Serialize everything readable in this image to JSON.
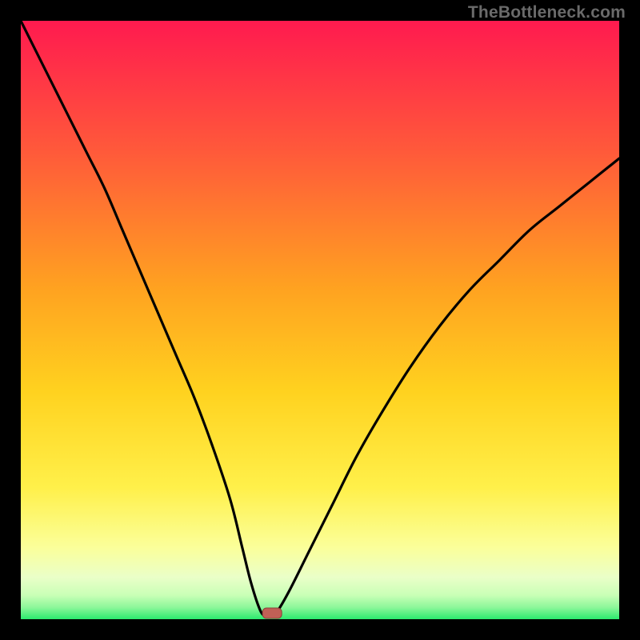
{
  "watermark": "TheBottleneck.com",
  "colors": {
    "frame": "#000000",
    "watermark_text": "#6a6a6a",
    "gradient_top": "#ff1a4f",
    "gradient_mid1": "#ff6a2f",
    "gradient_mid2": "#ffd21f",
    "gradient_mid3": "#fff56a",
    "gradient_mid4": "#f5ffd0",
    "gradient_bot": "#2bea6e",
    "curve": "#000000",
    "marker_fill": "#c06056",
    "marker_stroke": "#8d4039"
  },
  "chart_data": {
    "type": "line",
    "title": "",
    "xlabel": "",
    "ylabel": "",
    "xlim": [
      0,
      100
    ],
    "ylim": [
      0,
      100
    ],
    "series": [
      {
        "name": "bottleneck-curve",
        "x": [
          0,
          2,
          5,
          8,
          11,
          14,
          17,
          20,
          23,
          26,
          29,
          32,
          35,
          37,
          38.5,
          40,
          41,
          42,
          43,
          45,
          48,
          52,
          56,
          60,
          65,
          70,
          75,
          80,
          85,
          90,
          95,
          100
        ],
        "y": [
          100,
          96,
          90,
          84,
          78,
          72,
          65,
          58,
          51,
          44,
          37,
          29,
          20,
          12,
          6,
          1.5,
          0.5,
          0.5,
          1.5,
          5,
          11,
          19,
          27,
          34,
          42,
          49,
          55,
          60,
          65,
          69,
          73,
          77
        ]
      }
    ],
    "flat_start_x": 41,
    "flat_end_x": 43,
    "flat_y": 0.4,
    "marker": {
      "x": 42,
      "y": 1.0
    },
    "grid": false,
    "legend": false
  }
}
